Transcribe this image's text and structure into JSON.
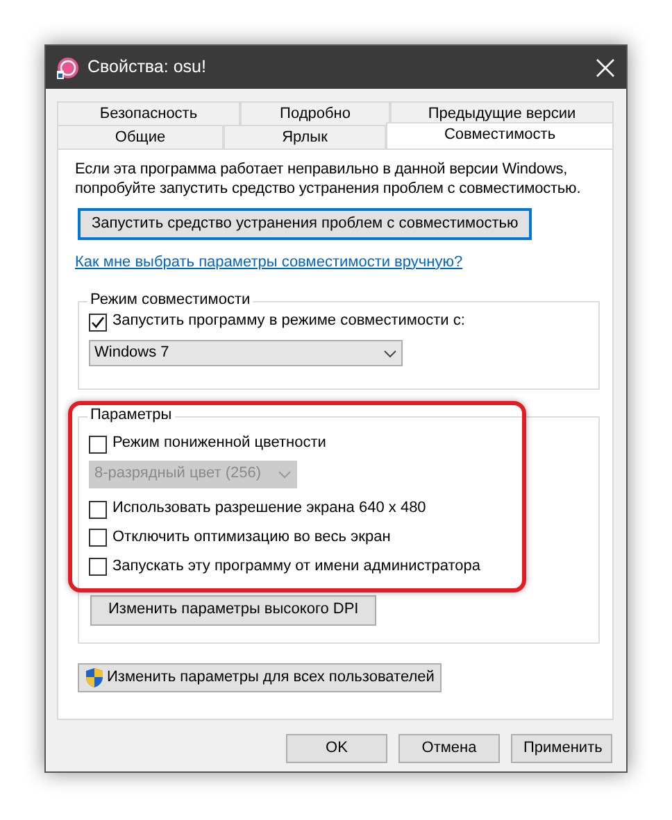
{
  "window": {
    "title": "Свойства: osu!"
  },
  "tab_rows": [
    [
      {
        "label": "Безопасность",
        "selected": false
      },
      {
        "label": "Подробно",
        "selected": false
      },
      {
        "label": "Предыдущие версии",
        "selected": false
      }
    ],
    [
      {
        "label": "Общие",
        "selected": false
      },
      {
        "label": "Ярлык",
        "selected": false
      },
      {
        "label": "Совместимость",
        "selected": true
      }
    ]
  ],
  "intro": "Если эта программа работает неправильно в данной версии Windows, попробуйте запустить средство устранения проблем с совместимостью.",
  "troubleshoot_button": "Запустить средство устранения проблем с совместимостью",
  "help_link": "Как мне выбрать параметры совместимости вручную?",
  "compat_group": {
    "title": "Режим совместимости",
    "checkbox": {
      "label": "Запустить программу в режиме совместимости с:",
      "checked": true
    },
    "select": {
      "value": "Windows 7",
      "disabled": false
    }
  },
  "settings_group": {
    "title": "Параметры",
    "highlighted": true,
    "items": [
      {
        "kind": "checkbox",
        "label": "Режим пониженной цветности",
        "checked": false
      },
      {
        "kind": "select",
        "value": "8-разрядный цвет (256)",
        "disabled": true
      },
      {
        "kind": "checkbox",
        "label": "Использовать разрешение экрана 640 x 480",
        "checked": false
      },
      {
        "kind": "checkbox",
        "label": "Отключить оптимизацию во весь экран",
        "checked": false
      },
      {
        "kind": "checkbox",
        "label": "Запускать эту программу от имени администратора",
        "checked": false
      }
    ],
    "dpi_button": "Изменить параметры высокого DPI"
  },
  "all_users_button": "Изменить параметры для всех пользователей",
  "buttons": [
    {
      "label": "OK"
    },
    {
      "label": "Отмена"
    },
    {
      "label": "Применить"
    }
  ]
}
